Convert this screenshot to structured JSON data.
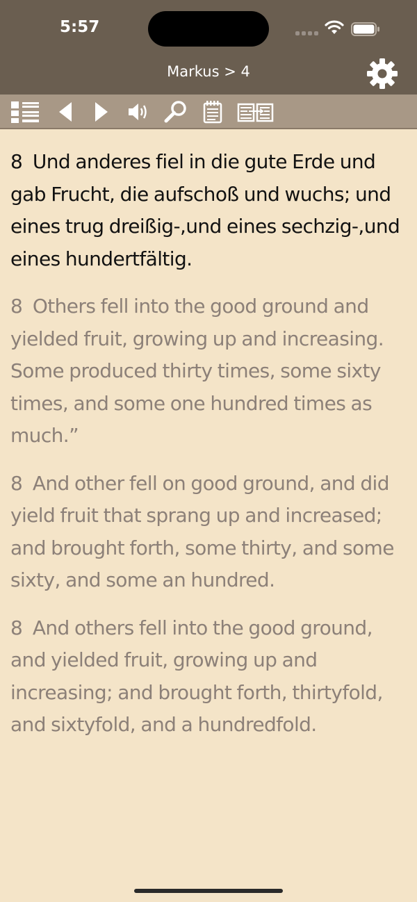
{
  "status_bar": {
    "time": "5:57"
  },
  "nav": {
    "title": "Markus > 4"
  },
  "toolbar": {
    "buttons": [
      {
        "icon": "list-icon"
      },
      {
        "icon": "previous-icon"
      },
      {
        "icon": "next-icon"
      },
      {
        "icon": "speaker-icon"
      },
      {
        "icon": "search-icon"
      },
      {
        "icon": "notes-icon"
      },
      {
        "icon": "compare-icon"
      }
    ]
  },
  "verses": [
    {
      "number": "8",
      "text": "Und anderes fiel in die gute Erde und gab Frucht, die aufschoß und wuchs;  und eines trug dreißig-,und eines sechzig-,und eines hundertfältig.",
      "style": "primary"
    },
    {
      "number": "8",
      "text": "Others fell into the good ground and yielded fruit, growing up and increasing. Some produced thirty times, some sixty times, and some one hundred times as much.”",
      "style": "secondary"
    },
    {
      "number": "8",
      "text": "And other fell on good ground, and did yield fruit that sprang up and increased; and brought forth, some thirty, and some sixty, and some an hundred.",
      "style": "secondary"
    },
    {
      "number": "8",
      "text": "And others fell into the good ground, and yielded fruit, growing up and increasing; and brought forth, thirtyfold, and sixtyfold, and a hundredfold.",
      "style": "secondary"
    }
  ],
  "colors": {
    "header": "#6a5e50",
    "toolbar": "#a89886",
    "background": "#f4e4c8",
    "primary_text": "#111111",
    "secondary_text": "#8c8078"
  }
}
